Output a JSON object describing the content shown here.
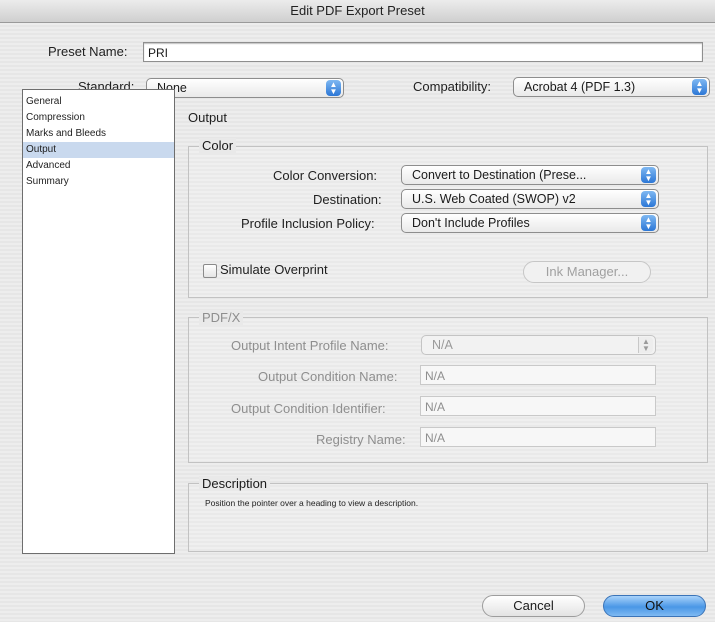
{
  "window": {
    "title": "Edit PDF Export Preset"
  },
  "preset": {
    "label": "Preset Name:",
    "value": "PRI"
  },
  "standard": {
    "label": "Standard:",
    "value": "None"
  },
  "compatibility": {
    "label": "Compatibility:",
    "value": "Acrobat 4 (PDF 1.3)"
  },
  "sidebar": {
    "items": [
      {
        "label": "General"
      },
      {
        "label": "Compression"
      },
      {
        "label": "Marks and Bleeds"
      },
      {
        "label": "Output"
      },
      {
        "label": "Advanced"
      },
      {
        "label": "Summary"
      }
    ],
    "selected": "Output"
  },
  "panel": {
    "title": "Output"
  },
  "color": {
    "title": "Color",
    "conversion_label": "Color Conversion:",
    "conversion_value": "Convert to Destination (Prese...",
    "destination_label": "Destination:",
    "destination_value": "U.S. Web Coated (SWOP) v2",
    "profile_label": "Profile Inclusion Policy:",
    "profile_value": "Don't Include Profiles",
    "simulate_label": "Simulate Overprint",
    "simulate_checked": false,
    "ink_manager_label": "Ink Manager..."
  },
  "pdfx": {
    "title": "PDF/X",
    "intent_label": "Output Intent Profile Name:",
    "intent_value": "N/A",
    "condition_name_label": "Output Condition Name:",
    "condition_name_value": "N/A",
    "condition_id_label": "Output Condition Identifier:",
    "condition_id_value": "N/A",
    "registry_label": "Registry Name:",
    "registry_value": "N/A"
  },
  "description": {
    "title": "Description",
    "text": "Position the pointer over a heading to view a description."
  },
  "buttons": {
    "cancel": "Cancel",
    "ok": "OK"
  },
  "colors": {
    "selection": "#c9d9ee",
    "default_button": "#4a97e6",
    "popup_arrows": "#2c77d6"
  }
}
